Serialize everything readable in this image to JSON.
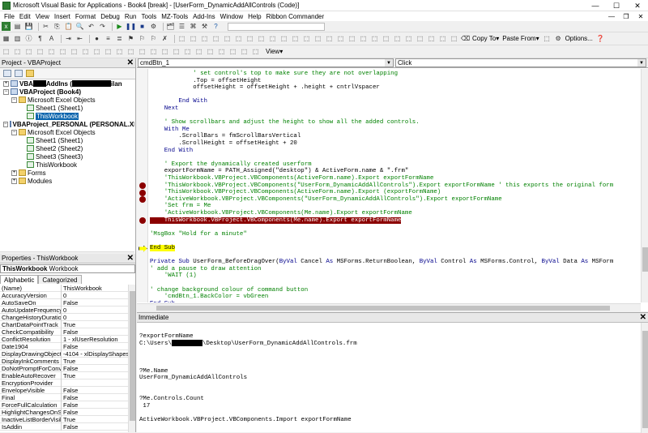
{
  "window": {
    "title": "Microsoft Visual Basic for Applications - Book4 [break] - [UserForm_DynamicAddAllControls (Code)]",
    "min": "—",
    "max": "☐",
    "close": "✕"
  },
  "menu": [
    "File",
    "Edit",
    "View",
    "Insert",
    "Format",
    "Debug",
    "Run",
    "Tools",
    "MZ-Tools",
    "Add-Ins",
    "Window",
    "Help",
    "Ribbon Commander"
  ],
  "toolbar": {
    "copy_to": "Copy To",
    "paste_from": "Paste From",
    "options": "Options...",
    "view": "View"
  },
  "project_pane": {
    "title": "Project - VBAProject",
    "tree": [
      {
        "label": "VBA",
        "label2": "AddIns (",
        "label3": "ilan",
        "level": 0,
        "exp": "+",
        "icon": "proj",
        "bold": true
      },
      {
        "label": "VBAProject (Book4)",
        "level": 0,
        "exp": "−",
        "icon": "proj",
        "bold": true
      },
      {
        "label": "Microsoft Excel Objects",
        "level": 1,
        "exp": "−",
        "icon": "fold"
      },
      {
        "label": "Sheet1 (Sheet1)",
        "level": 2,
        "icon": "sheet"
      },
      {
        "label": "ThisWorkbook",
        "level": 2,
        "icon": "sheet",
        "selected": true
      },
      {
        "label": "VBAProject_PERSONAL (PERSONAL.XLSB)",
        "level": 0,
        "exp": "−",
        "icon": "proj",
        "bold": true
      },
      {
        "label": "Microsoft Excel Objects",
        "level": 1,
        "exp": "−",
        "icon": "fold"
      },
      {
        "label": "Sheet1 (Sheet1)",
        "level": 2,
        "icon": "sheet"
      },
      {
        "label": "Sheet2 (Sheet2)",
        "level": 2,
        "icon": "sheet"
      },
      {
        "label": "Sheet3 (Sheet3)",
        "level": 2,
        "icon": "sheet"
      },
      {
        "label": "ThisWorkbook",
        "level": 2,
        "icon": "sheet"
      },
      {
        "label": "Forms",
        "level": 1,
        "exp": "+",
        "icon": "fold"
      },
      {
        "label": "Modules",
        "level": 1,
        "exp": "+",
        "icon": "fold"
      }
    ]
  },
  "properties_pane": {
    "title": "Properties - ThisWorkbook",
    "object_name": "ThisWorkbook",
    "object_type": "Workbook",
    "tabs": [
      "Alphabetic",
      "Categorized"
    ],
    "rows": [
      [
        "(Name)",
        "ThisWorkbook"
      ],
      [
        "AccuracyVersion",
        "0"
      ],
      [
        "AutoSaveOn",
        "False"
      ],
      [
        "AutoUpdateFrequency",
        "0"
      ],
      [
        "ChangeHistoryDuration",
        "0"
      ],
      [
        "ChartDataPointTrack",
        "True"
      ],
      [
        "CheckCompatibility",
        "False"
      ],
      [
        "ConflictResolution",
        "1 - xlUserResolution"
      ],
      [
        "Date1904",
        "False"
      ],
      [
        "DisplayDrawingObjects",
        "-4104 - xlDisplayShapes"
      ],
      [
        "DisplayInkComments",
        "True"
      ],
      [
        "DoNotPromptForConvert",
        "False"
      ],
      [
        "EnableAutoRecover",
        "True"
      ],
      [
        "EncryptionProvider",
        ""
      ],
      [
        "EnvelopeVisible",
        "False"
      ],
      [
        "Final",
        "False"
      ],
      [
        "ForceFullCalculation",
        "False"
      ],
      [
        "HighlightChangesOnScree",
        "False"
      ],
      [
        "InactiveListBorderVisible",
        "True"
      ],
      [
        "IsAddin",
        "False"
      ]
    ]
  },
  "code_pane": {
    "object_combo": "cmdBtn_1",
    "proc_combo": "Click",
    "lines": [
      {
        "t": "            ' set control's top to make sure they are not overlapping",
        "c": "cm"
      },
      {
        "t": "            .Top = offsetHeight",
        "c": ""
      },
      {
        "t": "            offsetHeight = offsetHeight + .height + cntrlVspacer",
        "c": ""
      },
      {
        "t": "",
        "c": ""
      },
      {
        "t": "        End With",
        "c": "kw"
      },
      {
        "t": "    Next",
        "c": "kw"
      },
      {
        "t": "",
        "c": ""
      },
      {
        "t": "    ' Show scrollbars and adjust the height to show all the added controls.",
        "c": "cm"
      },
      {
        "t": "    With Me",
        "c": "kw"
      },
      {
        "t": "        .ScrollBars = fmScrollBarsVertical",
        "c": ""
      },
      {
        "t": "        .ScrollHeight = offsetHeight + 20",
        "c": ""
      },
      {
        "t": "    End With",
        "c": "kw"
      },
      {
        "t": "",
        "c": ""
      },
      {
        "t": "    ' Export the dynamically created userform",
        "c": "cm"
      },
      {
        "t": "    exportFormName = PATH_Assigned(\"desktop\") & ActiveForm.name & \".frm\"",
        "c": ""
      },
      {
        "t": "    'ThisWorkbook.VBProject.VBComponents(ActiveForm.name).Export exportFormName",
        "c": "cm"
      },
      {
        "t": "    'ThisWorkbook.VBProject.VBComponents(\"UserForm_DynamicAddAllControls\").Export exportFormName ' this exports the original form",
        "c": "cm",
        "bp": true
      },
      {
        "t": "    'ThisWorkbook.VBProject.VBComponents(ActiveForm.name).Export (exportFormName)",
        "c": "cm",
        "bp": true
      },
      {
        "t": "    'ActiveWorkbook.VBProject.VBComponents(\"UserForm_DynamicAddAllControls\").Export exportFormName",
        "c": "cm",
        "bp": true
      },
      {
        "t": "    'Set frm = Me",
        "c": "cm"
      },
      {
        "t": "    'ActiveWorkbook.VBProject.VBComponents(Me.name).Export exportFormName",
        "c": "cm"
      },
      {
        "t": "    ThisWorkbook.VBProject.VBComponents(Me.name).Export exportFormName",
        "c": "bp",
        "bp": true
      },
      {
        "t": "",
        "c": ""
      },
      {
        "t": "'MsgBox \"Hold for a minute\"",
        "c": "cm"
      },
      {
        "t": "",
        "c": ""
      },
      {
        "t": "End Sub",
        "c": "exec",
        "arrow": true
      },
      {
        "t": "",
        "c": ""
      },
      {
        "t": "Private Sub UserForm_BeforeDragOver(ByVal Cancel As MSForms.ReturnBoolean, ByVal Control As MSForms.Control, ByVal Data As MSForm",
        "c": "kwmix"
      },
      {
        "t": "' add a pause to draw attention",
        "c": "cm"
      },
      {
        "t": "    'WAIT (1)",
        "c": "cm"
      },
      {
        "t": "",
        "c": ""
      },
      {
        "t": "' change background colour of command button",
        "c": "cm"
      },
      {
        "t": "    'cmdBtn_1.BackColor = vbGreen",
        "c": "cm"
      },
      {
        "t": "End Sub",
        "c": "kw"
      }
    ]
  },
  "immediate": {
    "title": "Immediate",
    "text_lines": [
      "",
      "?exportFormName",
      "C:\\Users\\",
      "",
      "",
      "",
      "?Me.Name",
      "UserForm_DynamicAddAllControls",
      "",
      "",
      "?Me.Controls.Count",
      " 17",
      "",
      "ActiveWorkbook.VBProject.VBComponents.Import exportFormName"
    ],
    "path_suffix": "\\Desktop\\UserForm_DynamicAddAllControls.frm"
  }
}
